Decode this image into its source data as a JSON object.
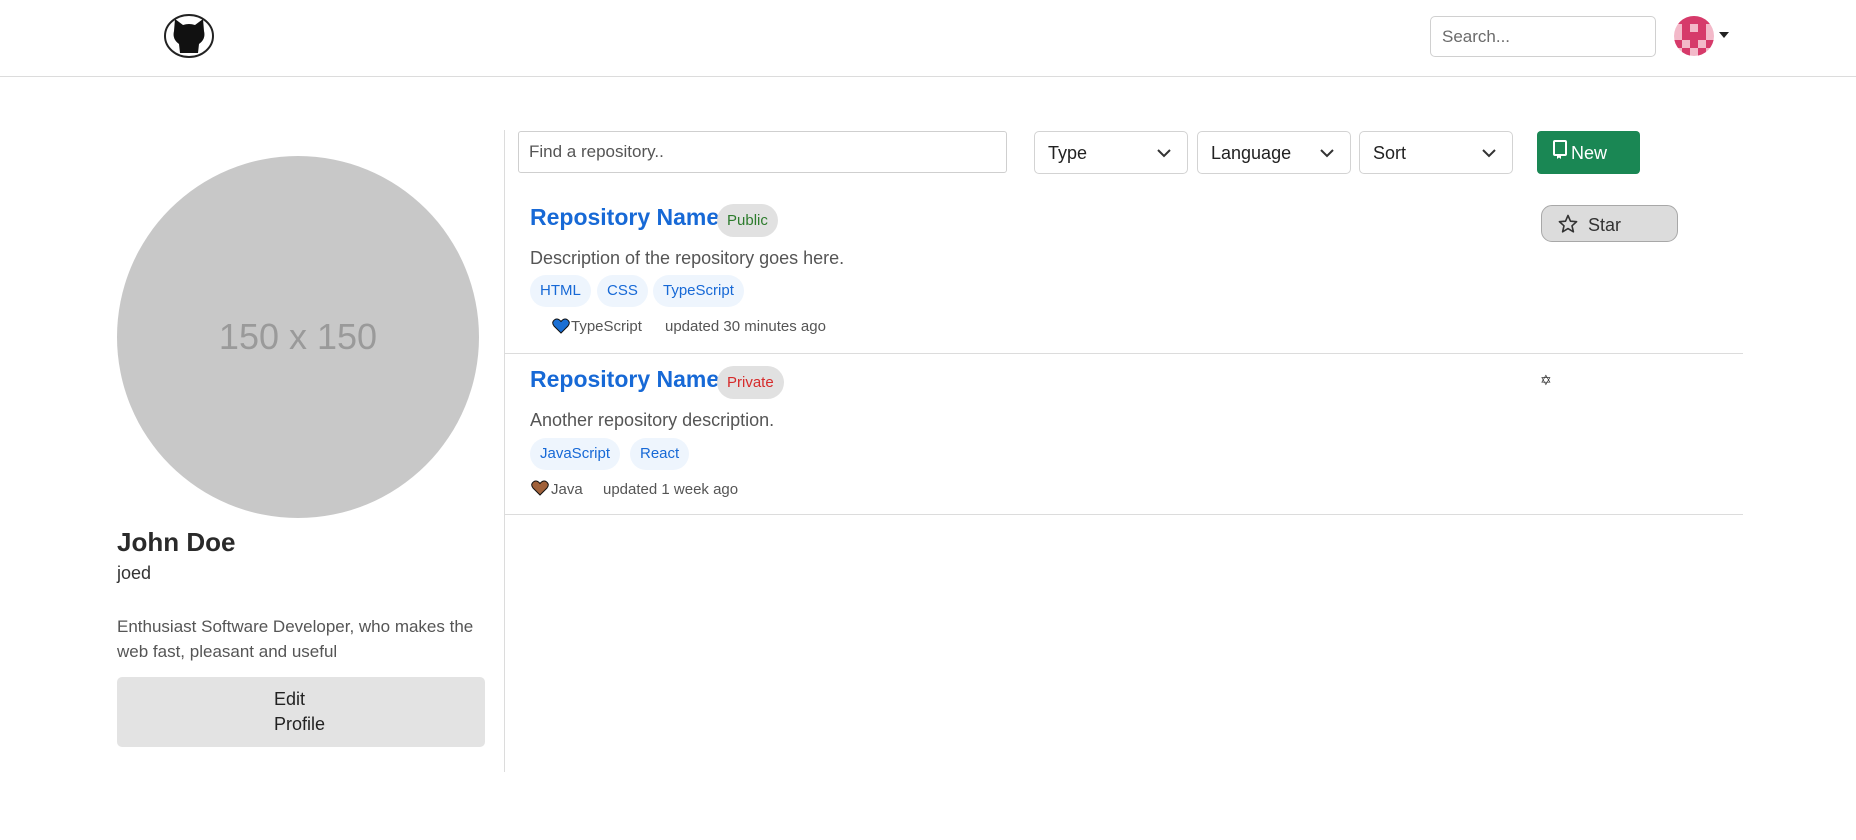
{
  "header": {
    "logo_icon": "github-octocat-icon",
    "search_placeholder": "Search...",
    "avatar_icon": "identicon-avatar",
    "avatar_colors": [
      "#d63a6a",
      "#f3b9c9"
    ]
  },
  "profile": {
    "image_placeholder": "150 x 150",
    "full_name": "John Doe",
    "username": "joed",
    "bio": "Enthusiast Software Developer, who makes the web fast, pleasant and useful",
    "edit_button_line1": "Edit",
    "edit_button_line2": "Profile"
  },
  "filters": {
    "find_placeholder": "Find a repository..",
    "type_label": "Type",
    "language_label": "Language",
    "sort_label": "Sort",
    "new_button_label": "New",
    "new_button_color": "#1a8754"
  },
  "repos": [
    {
      "name": "Repository Name",
      "visibility": "Public",
      "description": "Description of the repository goes here.",
      "tags": [
        "HTML",
        "CSS",
        "TypeScript"
      ],
      "language": "TypeScript",
      "language_color": "#1a6fd4",
      "updated": "updated 30 minutes ago",
      "star_label": "Star"
    },
    {
      "name": "Repository Name",
      "visibility": "Private",
      "description": "Another repository description.",
      "tags": [
        "JavaScript",
        "React"
      ],
      "language": "Java",
      "language_color": "#a0613a",
      "updated": "updated 1 week ago",
      "star_label": "✡"
    }
  ]
}
